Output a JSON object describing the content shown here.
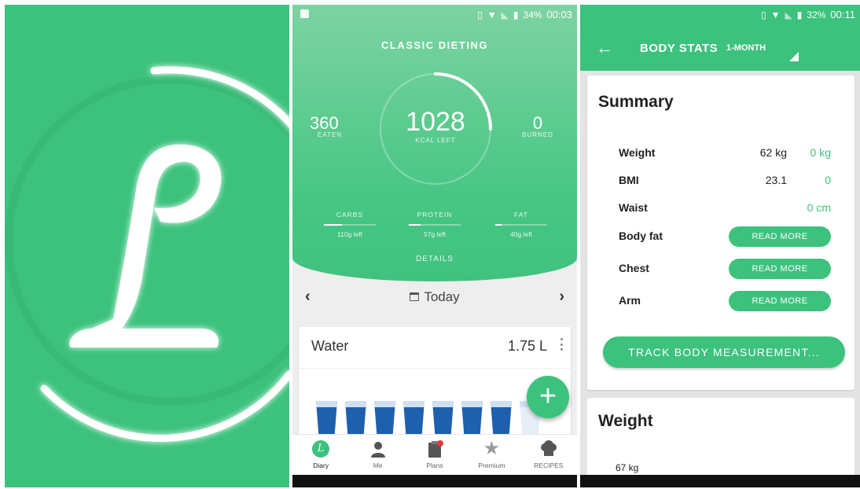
{
  "colors": {
    "brand_green": "#3cc27d",
    "water_blue": "#1e5fae"
  },
  "splash": {
    "logo_icon": "lifesum-script-L-logo"
  },
  "diary": {
    "status": {
      "battery": "34%",
      "time": "00:03"
    },
    "plan_title": "CLASSIC DIETING",
    "kcal_left": {
      "value": "1028",
      "label": "KCAL LEFT"
    },
    "eaten": {
      "value": "360",
      "label": "EATEN"
    },
    "burned": {
      "value": "0",
      "label": "BURNED"
    },
    "macros": [
      {
        "label": "CARBS",
        "left": "110g left",
        "progress": 0.35
      },
      {
        "label": "PROTEIN",
        "left": "57g left",
        "progress": 0.22
      },
      {
        "label": "FAT",
        "left": "40g left",
        "progress": 0.12
      }
    ],
    "details_label": "DETAILS",
    "date": {
      "prev_icon": "chevron-left",
      "label": "Today",
      "next_icon": "chevron-right"
    },
    "water": {
      "title": "Water",
      "amount": "1.75 L",
      "glasses_filled": 7,
      "glasses_total": 8
    },
    "fab_icon": "plus",
    "nav": [
      {
        "label": "Diary",
        "icon": "diary-logo-icon",
        "active": true
      },
      {
        "label": "Me",
        "icon": "person-icon"
      },
      {
        "label": "Plans",
        "icon": "clipboard-icon"
      },
      {
        "label": "Premium",
        "icon": "star-icon"
      },
      {
        "label": "RECIPES",
        "icon": "chef-hat-icon"
      }
    ]
  },
  "stats": {
    "status": {
      "battery": "32%",
      "time": "00:11"
    },
    "title": "BODY STATS",
    "period": "1-MONTH",
    "summary_title": "Summary",
    "rows": [
      {
        "label": "Weight",
        "value": "62 kg",
        "change": "0 kg"
      },
      {
        "label": "BMI",
        "value": "23.1",
        "change": "0"
      },
      {
        "label": "Waist",
        "value": "",
        "change": "0 cm"
      },
      {
        "label": "Body fat",
        "button": "READ MORE"
      },
      {
        "label": "Chest",
        "button": "READ MORE"
      },
      {
        "label": "Arm",
        "button": "READ MORE"
      }
    ],
    "track_button": "TRACK BODY MEASUREMENT...",
    "weight_title": "Weight",
    "weight_axis_label": "67 kg"
  }
}
